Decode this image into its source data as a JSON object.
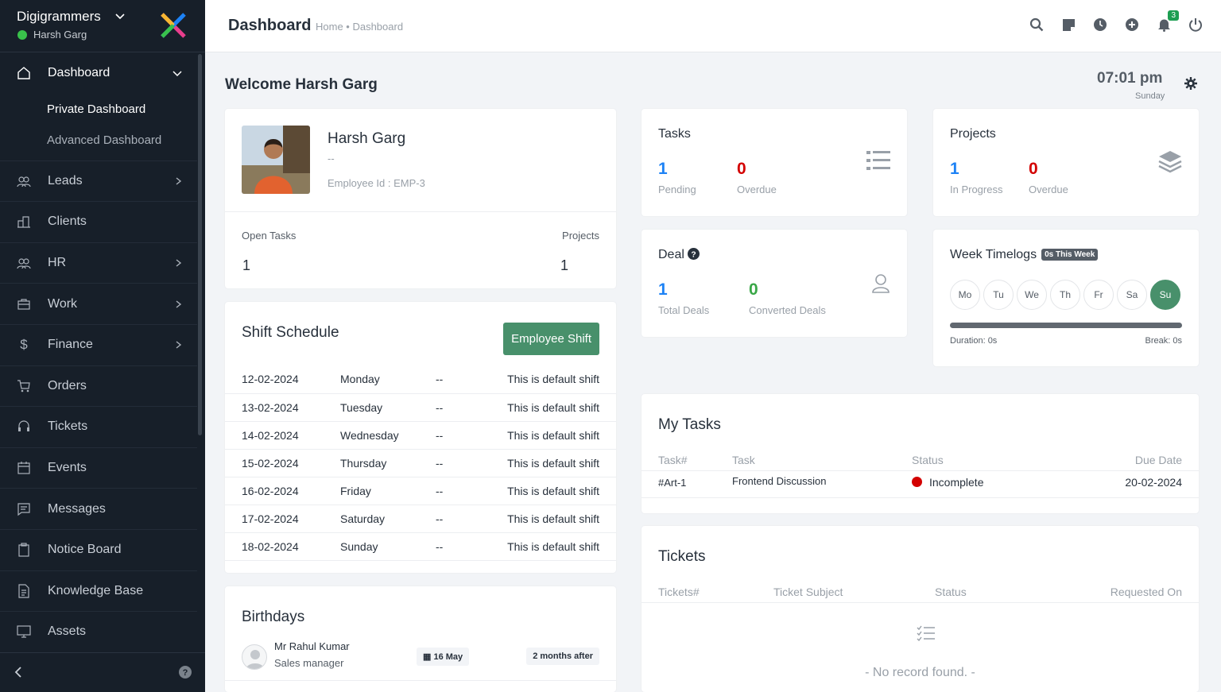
{
  "brand": {
    "name": "Digigrammers",
    "user": "Harsh Garg"
  },
  "sidebar": {
    "dashboard": {
      "label": "Dashboard",
      "sub": [
        "Private Dashboard",
        "Advanced Dashboard"
      ]
    },
    "items": [
      {
        "label": "Leads",
        "icon": "users-icon",
        "chevron": true
      },
      {
        "label": "Clients",
        "icon": "building-icon",
        "chevron": false
      },
      {
        "label": "HR",
        "icon": "people-icon",
        "chevron": true
      },
      {
        "label": "Work",
        "icon": "briefcase-icon",
        "chevron": true
      },
      {
        "label": "Finance",
        "icon": "dollar-icon",
        "chevron": true
      },
      {
        "label": "Orders",
        "icon": "cart-icon",
        "chevron": false
      },
      {
        "label": "Tickets",
        "icon": "headset-icon",
        "chevron": false
      },
      {
        "label": "Events",
        "icon": "calendar-icon",
        "chevron": false
      },
      {
        "label": "Messages",
        "icon": "message-icon",
        "chevron": false
      },
      {
        "label": "Notice Board",
        "icon": "clipboard-icon",
        "chevron": false
      },
      {
        "label": "Knowledge Base",
        "icon": "document-icon",
        "chevron": false
      },
      {
        "label": "Assets",
        "icon": "monitor-icon",
        "chevron": false
      }
    ]
  },
  "header": {
    "title": "Dashboard",
    "breadcrumb": "Home • Dashboard",
    "notification_count": "3"
  },
  "welcome": "Welcome Harsh Garg",
  "clock": {
    "time": "07:01 pm",
    "day": "Sunday"
  },
  "profile": {
    "name": "Harsh Garg",
    "designation": "--",
    "employee_id": "Employee Id : EMP-3",
    "open_tasks_label": "Open Tasks",
    "open_tasks": "1",
    "projects_label": "Projects",
    "projects": "1"
  },
  "tasks": {
    "title": "Tasks",
    "pending": "1",
    "pending_label": "Pending",
    "overdue": "0",
    "overdue_label": "Overdue"
  },
  "projects": {
    "title": "Projects",
    "in_progress": "1",
    "in_progress_label": "In Progress",
    "overdue": "0",
    "overdue_label": "Overdue"
  },
  "deal": {
    "title": "Deal",
    "total": "1",
    "total_label": "Total Deals",
    "converted": "0",
    "converted_label": "Converted Deals"
  },
  "timelogs": {
    "title": "Week Timelogs",
    "badge": "0s This Week",
    "days": [
      "Mo",
      "Tu",
      "We",
      "Th",
      "Fr",
      "Sa",
      "Su"
    ],
    "active_day": "Su",
    "duration": "Duration: 0s",
    "break": "Break: 0s"
  },
  "shift": {
    "title": "Shift Schedule",
    "button": "Employee Shift",
    "rows": [
      [
        "12-02-2024",
        "Monday",
        "--",
        "This is default shift"
      ],
      [
        "13-02-2024",
        "Tuesday",
        "--",
        "This is default shift"
      ],
      [
        "14-02-2024",
        "Wednesday",
        "--",
        "This is default shift"
      ],
      [
        "15-02-2024",
        "Thursday",
        "--",
        "This is default shift"
      ],
      [
        "16-02-2024",
        "Friday",
        "--",
        "This is default shift"
      ],
      [
        "17-02-2024",
        "Saturday",
        "--",
        "This is default shift"
      ],
      [
        "18-02-2024",
        "Sunday",
        "--",
        "This is default shift"
      ]
    ]
  },
  "birthdays": {
    "title": "Birthdays",
    "name": "Mr Rahul Kumar",
    "role": "Sales manager",
    "date": "16 May",
    "relative": "2 months after"
  },
  "my_tasks": {
    "title": "My Tasks",
    "columns": [
      "Task#",
      "Task",
      "Status",
      "Due Date"
    ],
    "rows": [
      {
        "id": "#Art-1",
        "task": "Frontend Discussion",
        "status": "Incomplete",
        "due": "20-02-2024"
      }
    ]
  },
  "tickets": {
    "title": "Tickets",
    "columns": [
      "Tickets#",
      "Ticket Subject",
      "Status",
      "Requested On"
    ],
    "empty": "- No record found. -"
  },
  "colors": {
    "sidebar": "#171f29",
    "accent_green": "#48906b",
    "blue": "#1d82f5",
    "red": "#d30000",
    "green": "#39a747"
  }
}
